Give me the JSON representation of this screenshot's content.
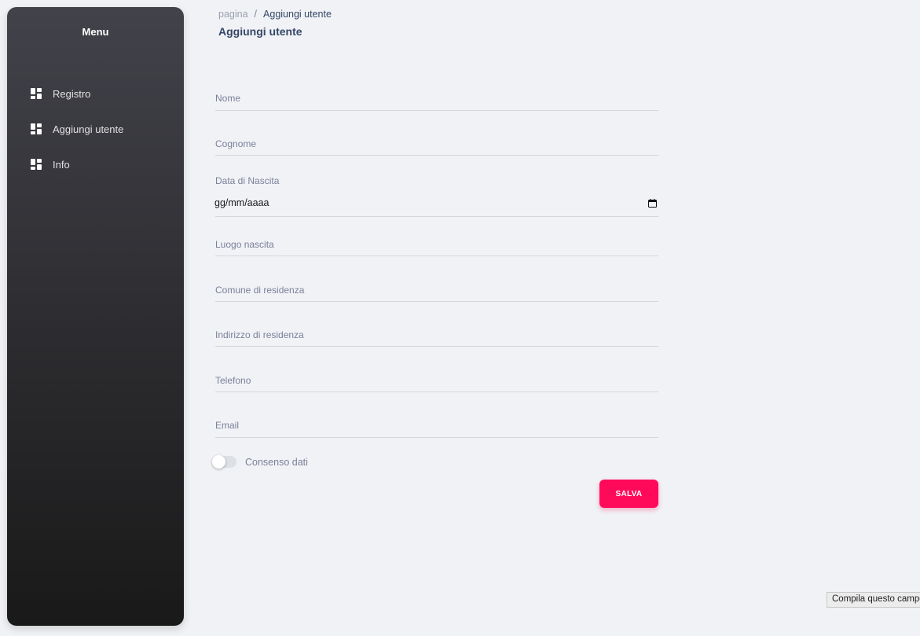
{
  "sidebar": {
    "title": "Menu",
    "items": [
      {
        "label": "Registro",
        "icon": "dashboard-icon"
      },
      {
        "label": "Aggiungi utente",
        "icon": "dashboard-icon"
      },
      {
        "label": "Info",
        "icon": "dashboard-icon"
      }
    ]
  },
  "breadcrumb": {
    "root": "pagina",
    "separator": "/",
    "current": "Aggiungi utente"
  },
  "page": {
    "title": "Aggiungi utente"
  },
  "form": {
    "nome": {
      "label": "Nome",
      "value": ""
    },
    "cognome": {
      "label": "Cognome",
      "value": ""
    },
    "data_nascita": {
      "label": "Data di Nascita",
      "value": "gg/mm/aaaa"
    },
    "luogo_nascita": {
      "label": "Luogo nascita",
      "value": ""
    },
    "comune_residenza": {
      "label": "Comune di residenza",
      "value": ""
    },
    "indirizzo_residenza": {
      "label": "Indirizzo di residenza",
      "value": ""
    },
    "telefono": {
      "label": "Telefono",
      "value": ""
    },
    "email": {
      "label": "Email",
      "value": ""
    },
    "consenso": {
      "label": "Consenso dati",
      "checked": false
    },
    "save_label": "SALVA"
  },
  "tooltip": {
    "text": "Compila questo campo"
  },
  "colors": {
    "accent": "#ff0a5b",
    "sidebar_top": "#42424a",
    "sidebar_bottom": "#191919",
    "background": "#f0f2f5",
    "text": "#344767"
  }
}
